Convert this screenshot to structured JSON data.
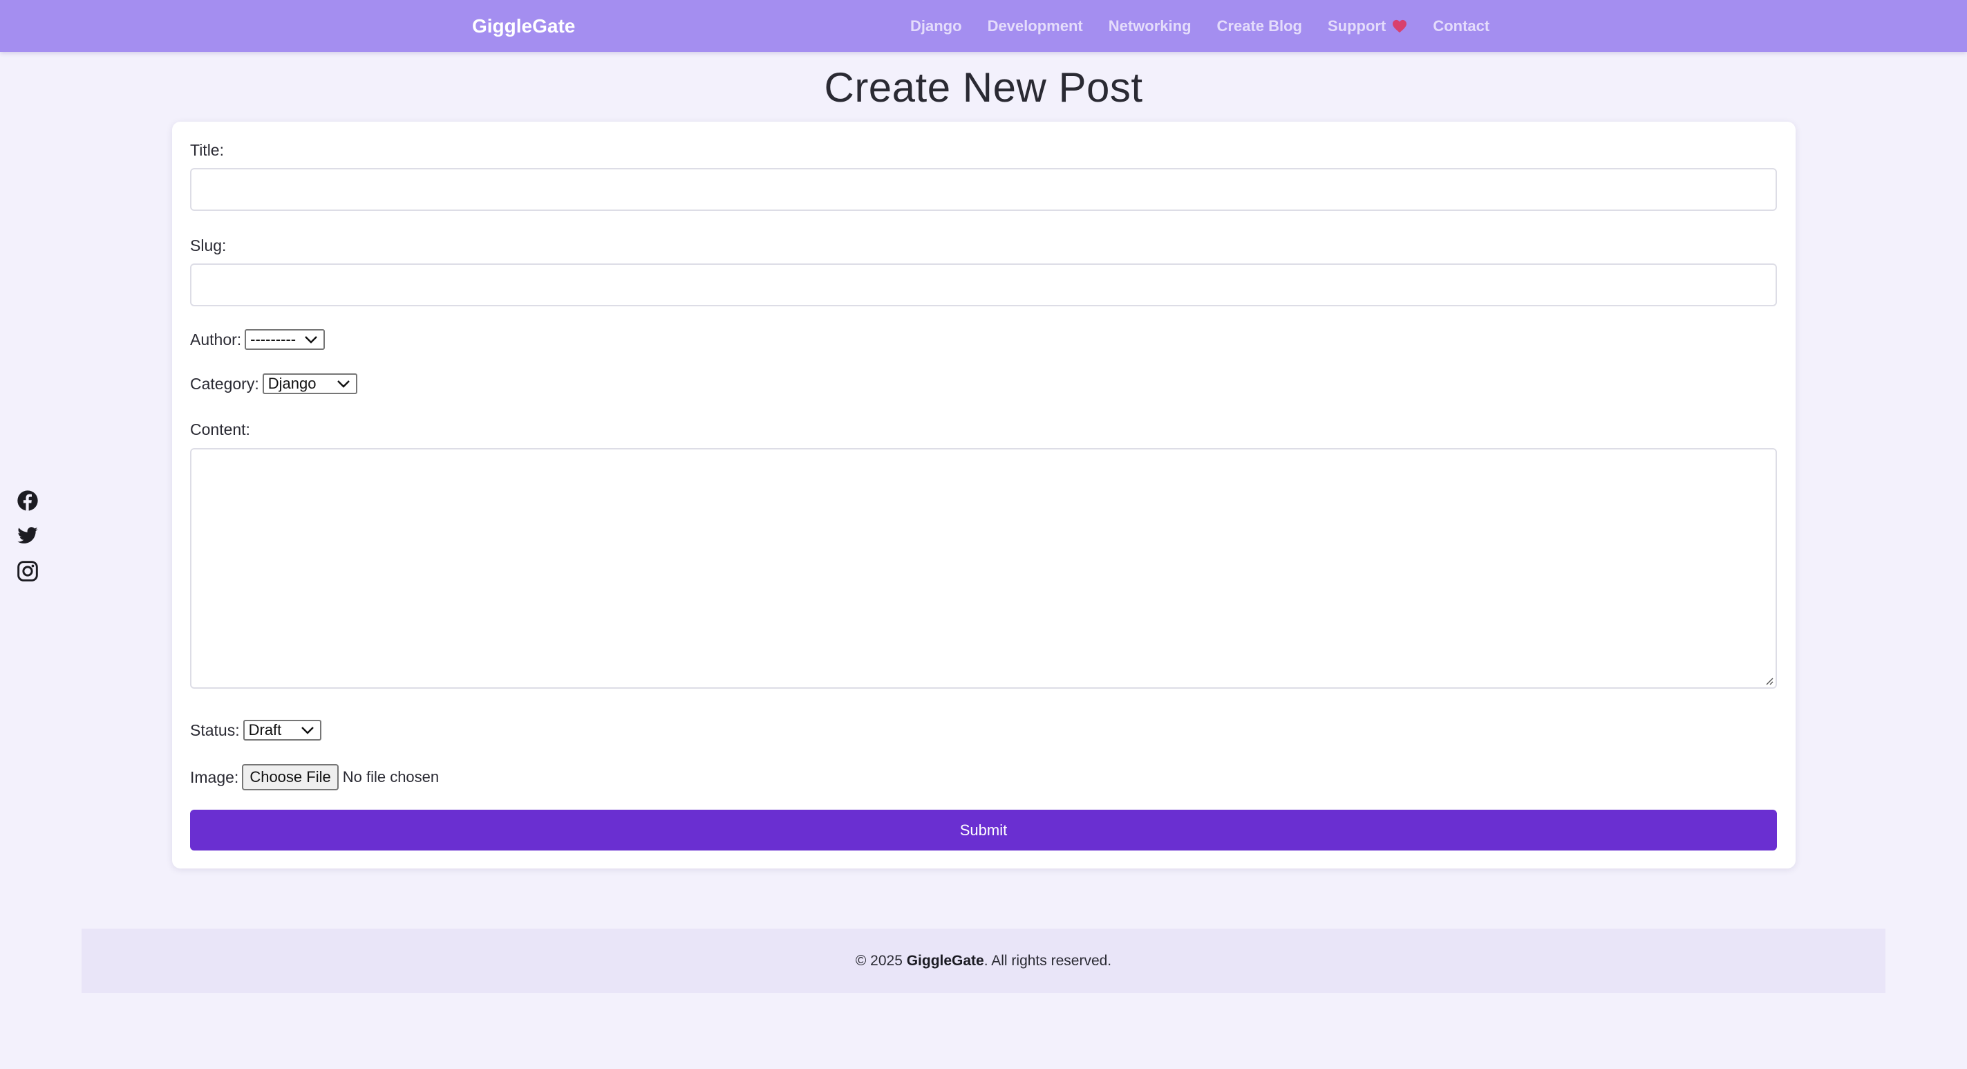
{
  "navbar": {
    "brand": "GiggleGate",
    "links": [
      {
        "label": "Django"
      },
      {
        "label": "Development"
      },
      {
        "label": "Networking"
      },
      {
        "label": "Create Blog"
      },
      {
        "label": "Support",
        "icon": "heart-icon"
      },
      {
        "label": "Contact"
      }
    ]
  },
  "social": {
    "icons": [
      "facebook-icon",
      "twitter-icon",
      "instagram-icon"
    ]
  },
  "page": {
    "title": "Create New Post"
  },
  "form": {
    "title_label": "Title:",
    "title_value": "",
    "slug_label": "Slug:",
    "slug_value": "",
    "author_label": "Author:",
    "author_selected": "---------",
    "category_label": "Category:",
    "category_selected": "Django",
    "content_label": "Content:",
    "content_value": "",
    "status_label": "Status:",
    "status_selected": "Draft",
    "image_label": "Image:",
    "image_button": "Choose File",
    "image_status": "No file chosen",
    "submit_label": "Submit"
  },
  "footer": {
    "prefix": "© 2025 ",
    "brand": "GiggleGate",
    "suffix": ". All rights reserved."
  },
  "colors": {
    "navbar_bg": "#a48ef0",
    "page_bg": "#f3f1fc",
    "submit_bg": "#6a2fd1",
    "footer_bg": "#e9e5f8",
    "heart": "#d9406e"
  }
}
